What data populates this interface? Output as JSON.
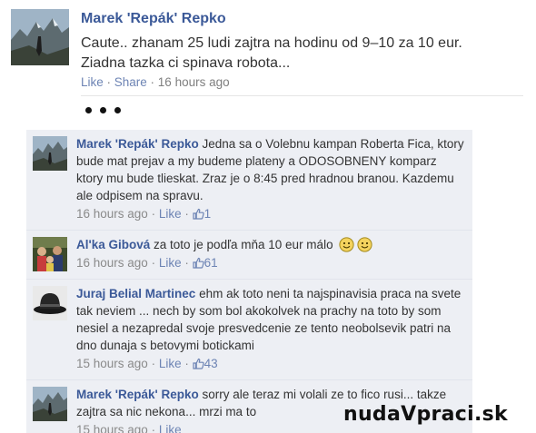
{
  "post": {
    "author": "Marek 'Repák' Repko",
    "message_line1": "Caute.. zhanam 25 ludi zajtra na hodinu od 9–10 za 10 eur.",
    "message_line2": "Ziadna tazka ci spinava robota...",
    "like_label": "Like",
    "separator": " · ",
    "share_label": "Share",
    "timestamp": "16 hours ago"
  },
  "comments": [
    {
      "author": "Marek 'Repák' Repko",
      "text": "Jedna sa o Volebnu kampan Roberta Fica, ktory bude mat prejav a my budeme plateny a ODOSOBNENY komparz ktory mu bude tlieskat. Zraz je o 8:45 pred hradnou branou. Kazdemu ale odpisem na spravu.",
      "timestamp": "16 hours ago",
      "like_label": "Like",
      "likes": "1"
    },
    {
      "author": "Al'ka Gibová",
      "text": "za toto je podľa mňa 10 eur málo",
      "timestamp": "16 hours ago",
      "like_label": "Like",
      "likes": "61"
    },
    {
      "author": "Juraj Belial Martinec",
      "text": "ehm ak toto neni ta najspinavisia praca na svete tak neviem ... nech by som bol akokolvek na prachy na toto by som nesiel a nezapredal svoje presvedcenie ze tento neobolsevik patri na dno dunaja s betovymi botickami",
      "timestamp": "15 hours ago",
      "like_label": "Like",
      "likes": "43"
    },
    {
      "author": "Marek 'Repák' Repko",
      "text": "sorry ale teraz mi volali ze to fico rusi... takze zajtra sa nic nekona... mrzi ma to",
      "timestamp": "15 hours ago",
      "like_label": "Like"
    }
  ],
  "meta_separator": " · ",
  "watermark": "nudaVpraci.sk",
  "colors": {
    "link": "#3b5998",
    "action_link": "#6d84b4",
    "comment_background": "#edeff4",
    "muted_text": "#8a8a8a"
  },
  "icons": [
    "thumbs-up-icon",
    "smiley-icon",
    "avatar-mountain-photo",
    "avatar-family-photo",
    "avatar-hat-photo"
  ]
}
